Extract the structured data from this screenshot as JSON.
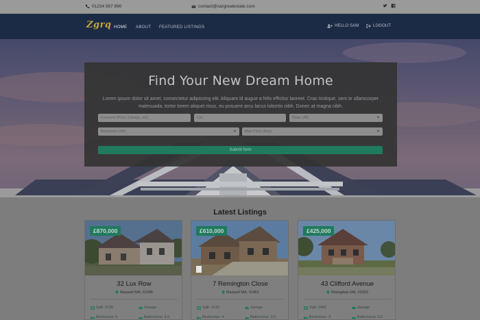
{
  "topbar": {
    "phone": "01234 567 890",
    "email": "contact@zargrealestate.com",
    "icons": [
      "phone-icon",
      "envelope-icon",
      "twitter-icon",
      "facebook-icon"
    ]
  },
  "nav": {
    "logo": "Zgrq",
    "links": [
      "HOME",
      "ABOUT",
      "FEATURED LISTINGS"
    ],
    "user": "HELLO SAM",
    "logout": "LOGOUT"
  },
  "search": {
    "title": "Find Your New Dream Home",
    "description": "Lorem ipsum dolor sit amet, consectetur adipiscing elit. Aliquam id augue a felis efficitur laoreet. Cras tristique, sem in ullamcorper malesuada, tortor lorem aliquet risus, eu posuere arcu lacus lobortis nibh. Donec at magna nibh.",
    "keyword_placeholder": "Keyword (Pool, Garage, etc)",
    "city_placeholder": "City",
    "state_value": "State (All)",
    "bedrooms_value": "Bedrooms (All)",
    "max_price_value": "Max Price (Any)",
    "submit_label": "Submit form"
  },
  "listings": {
    "heading": "Latest Listings",
    "items": [
      {
        "price": "£870,000",
        "name": "32 Lux Row",
        "address": "Maxwell MA, 01945",
        "sqft": "Sqft: 6235",
        "garage": "Garage",
        "bedrooms": "Bedrooms: 6",
        "bathrooms": "Bathrooms: 4.0"
      },
      {
        "price": "£610,000",
        "name": "7 Remington Close",
        "address": "Maxwell MA, 01451",
        "sqft": "Sqft: 4120",
        "garage": "Garage",
        "bedrooms": "Bedrooms: 4",
        "bathrooms": "Bathrooms: 3.0"
      },
      {
        "price": "£425,000",
        "name": "43 Clifford Avenue",
        "address": "Risingdale MA, 01563",
        "sqft": "Sqft: 2460",
        "garage": "Garage",
        "bedrooms": "Bedrooms: 3",
        "bathrooms": "Bathrooms: 2.0"
      }
    ]
  },
  "colors": {
    "navbar": "#1c2b45",
    "accent_green": "#1f7a5e",
    "logo_gold": "#c8a43a"
  }
}
